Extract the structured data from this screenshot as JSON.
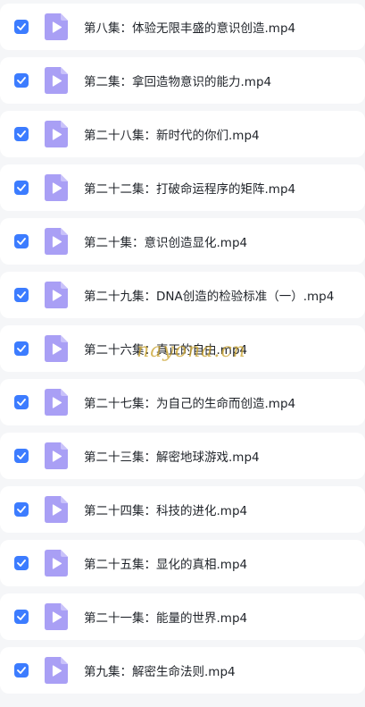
{
  "colors": {
    "checkbox": "#3c7cff",
    "file_icon": "#a99ff5",
    "file_icon_play": "#ffffff",
    "row_bg": "#ffffff",
    "page_bg": "#f5f6f8",
    "text": "#1f2329"
  },
  "files": [
    {
      "name": "第八集：体验无限丰盛的意识创造.mp4",
      "checked": true,
      "icon": "video-file-icon"
    },
    {
      "name": "第二集：拿回造物意识的能力.mp4",
      "checked": true,
      "icon": "video-file-icon"
    },
    {
      "name": "第二十八集：新时代的你们.mp4",
      "checked": true,
      "icon": "video-file-icon"
    },
    {
      "name": "第二十二集：打破命运程序的矩阵.mp4",
      "checked": true,
      "icon": "video-file-icon"
    },
    {
      "name": "第二十集：意识创造显化.mp4",
      "checked": true,
      "icon": "video-file-icon"
    },
    {
      "name": "第二十九集：DNA创造的检验标准（一）.mp4",
      "checked": true,
      "icon": "video-file-icon"
    },
    {
      "name": "第二十六集：真正的自由.mp4",
      "checked": true,
      "icon": "video-file-icon"
    },
    {
      "name": "第二十七集：为自己的生命而创造.mp4",
      "checked": true,
      "icon": "video-file-icon"
    },
    {
      "name": "第二十三集：解密地球游戏.mp4",
      "checked": true,
      "icon": "video-file-icon"
    },
    {
      "name": "第二十四集：科技的进化.mp4",
      "checked": true,
      "icon": "video-file-icon"
    },
    {
      "name": "第二十五集：显化的真相.mp4",
      "checked": true,
      "icon": "video-file-icon"
    },
    {
      "name": "第二十一集：能量的世界.mp4",
      "checked": true,
      "icon": "video-file-icon"
    },
    {
      "name": "第九集：解密生命法则.mp4",
      "checked": true,
      "icon": "video-file-icon"
    }
  ],
  "watermark": "nayona.cn"
}
